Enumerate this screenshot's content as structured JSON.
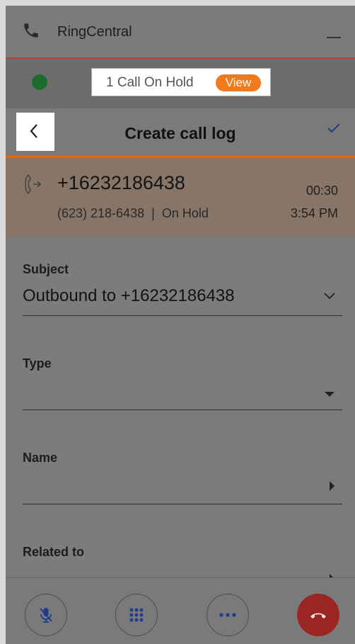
{
  "app": {
    "title": "RingCentral"
  },
  "hold_bar": {
    "text": "1 Call On Hold",
    "view_label": "View"
  },
  "header": {
    "title": "Create call log"
  },
  "call": {
    "number": "+16232186438",
    "duration": "00:30",
    "sub_number": "(623) 218-6438",
    "separator": "|",
    "status": "On Hold",
    "time": "3:54 PM"
  },
  "form": {
    "subject_label": "Subject",
    "subject_value": "Outbound to +16232186438",
    "type_label": "Type",
    "type_value": "",
    "name_label": "Name",
    "name_value": "",
    "related_label": "Related to",
    "related_value": ""
  },
  "colors": {
    "accent": "#f07a1c",
    "online": "#1b6b2b",
    "hangup": "#9b2523",
    "button_blue": "#1f3c8a"
  },
  "icons": [
    "phone-icon",
    "minimize-icon",
    "status-dot",
    "back-icon",
    "check-icon",
    "outbound-call-icon",
    "chevron-down-icon",
    "caret-down-icon",
    "caret-right-icon",
    "mute-icon",
    "keypad-icon",
    "more-icon",
    "hangup-icon"
  ]
}
